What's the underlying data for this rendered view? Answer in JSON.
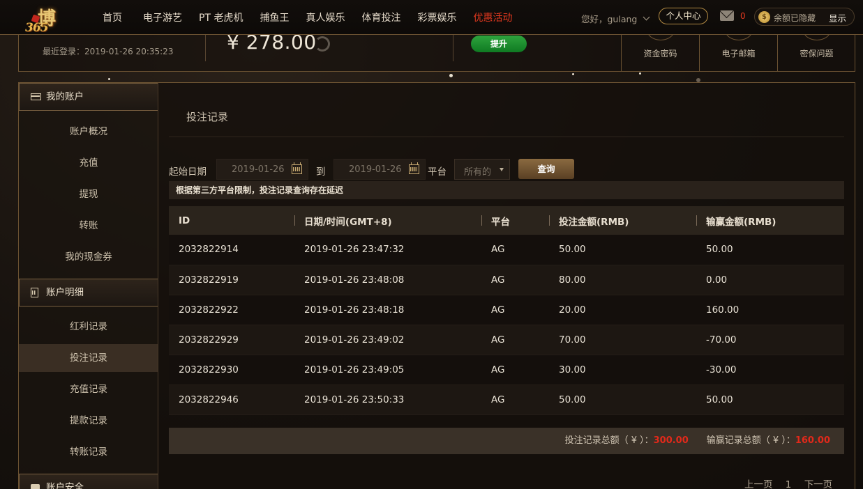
{
  "logo": {
    "top": "博",
    "bottom": "365"
  },
  "nav": {
    "items": [
      "首页",
      "电子游艺",
      "PT 老虎机",
      "捕鱼王",
      "真人娱乐",
      "体育投注",
      "彩票娱乐",
      "优惠活动"
    ]
  },
  "user": {
    "greeting": "您好，gulang",
    "personal_center": "个人中心",
    "mail_count": "0",
    "balance_hidden": "余额已隐藏",
    "show_label": "显示"
  },
  "account": {
    "last_login": "最近登录：2019-01-26 20:35:23",
    "amount": "¥ 278.00",
    "upgrade_label": "提升",
    "security": [
      "资金密码",
      "电子邮箱",
      "密保问题"
    ]
  },
  "sidebar": {
    "sections": [
      {
        "title": "我的账户",
        "items": [
          "账户概况",
          "充值",
          "提现",
          "转账",
          "我的现金券"
        ]
      },
      {
        "title": "账户明细",
        "items": [
          "红利记录",
          "投注记录",
          "充值记录",
          "提款记录",
          "转账记录"
        ]
      },
      {
        "title": "账户安全"
      }
    ],
    "active_item": "投注记录"
  },
  "main": {
    "title": "投注记录",
    "filters": {
      "start_label": "起始日期",
      "start_date": "2019-01-26",
      "to_label": "到",
      "end_date": "2019-01-26",
      "platform_label": "平台",
      "platform_value": "所有的",
      "query_label": "查询"
    },
    "notice": "根据第三方平台限制，投注记录查询存在延迟",
    "table": {
      "headers": [
        "ID",
        "日期/时间(GMT+8)",
        "平台",
        "投注金额(RMB)",
        "输赢金额(RMB)"
      ],
      "rows": [
        [
          "2032822914",
          "2019-01-26 23:47:32",
          "AG",
          "50.00",
          "50.00"
        ],
        [
          "2032822919",
          "2019-01-26 23:48:08",
          "AG",
          "80.00",
          "0.00"
        ],
        [
          "2032822922",
          "2019-01-26 23:48:18",
          "AG",
          "20.00",
          "160.00"
        ],
        [
          "2032822929",
          "2019-01-26 23:49:02",
          "AG",
          "70.00",
          "-70.00"
        ],
        [
          "2032822930",
          "2019-01-26 23:49:05",
          "AG",
          "30.00",
          "-30.00"
        ],
        [
          "2032822946",
          "2019-01-26 23:50:33",
          "AG",
          "50.00",
          "50.00"
        ]
      ]
    },
    "totals": {
      "bet_label": "投注记录总额（ ¥ ）：",
      "bet_value": "300.00",
      "win_label": "输赢记录总额（ ¥ ）：",
      "win_value": "160.00"
    },
    "pager": {
      "prev": "上一页",
      "page": "1",
      "next": "下一页"
    }
  },
  "colors": {
    "accent": "#e4391f",
    "gold": "#b38b43",
    "total_red": "#e2291a"
  }
}
